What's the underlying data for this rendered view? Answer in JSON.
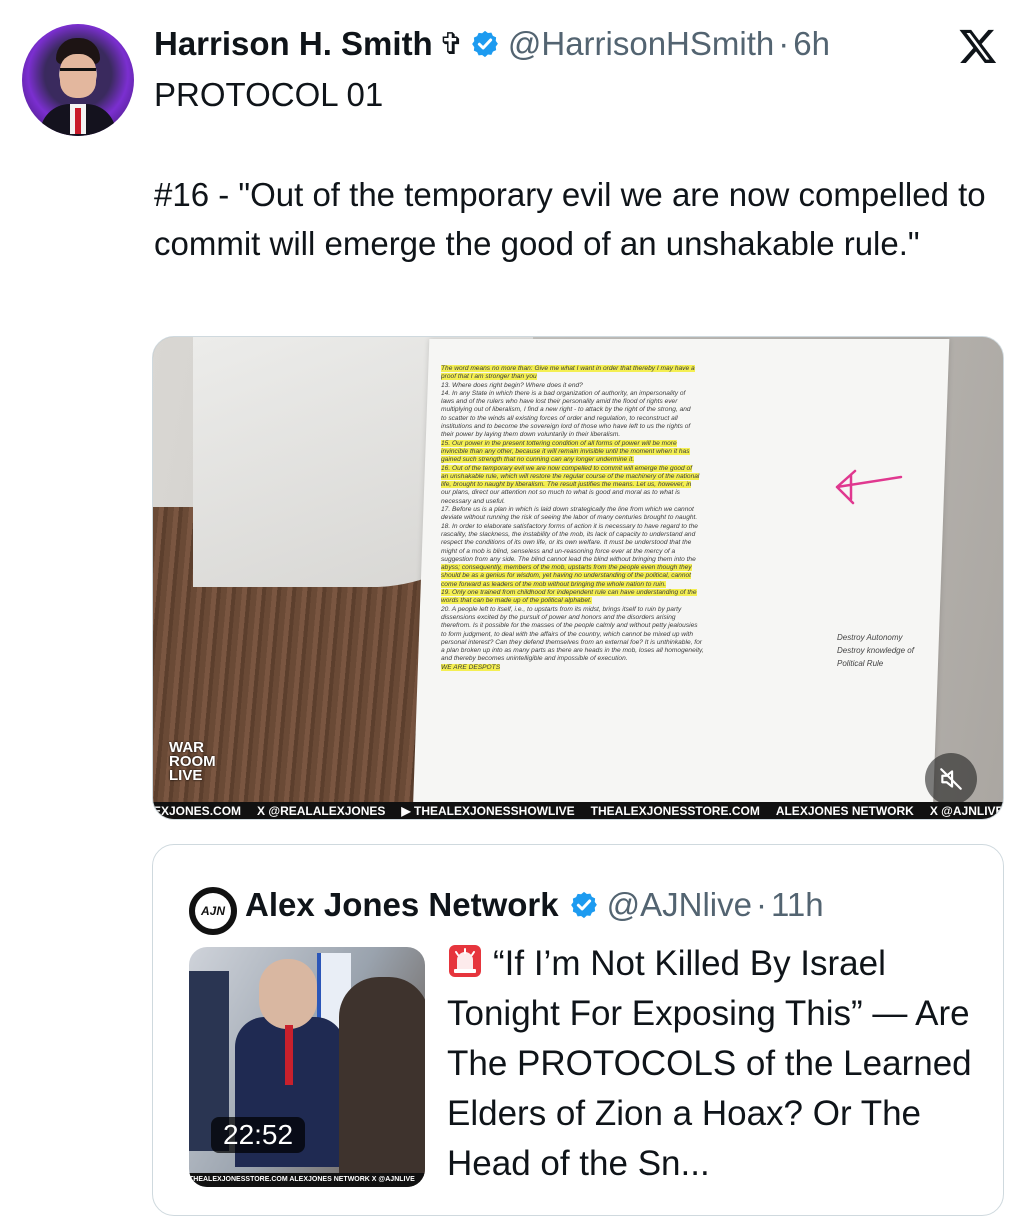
{
  "post": {
    "author_name": "Harrison H. Smith",
    "author_symbol": "✞",
    "author_handle": "@HarrisonHSmith",
    "separator": "·",
    "time": "6h",
    "subtitle": "PROTOCOL 01",
    "body": "#16 - \"Out of the temporary evil we are now compelled to commit will emerge the good of an unshakable rule.\""
  },
  "media": {
    "overlay_logo": [
      "WAR",
      "ROOM",
      "LIVE"
    ],
    "ticker": [
      "EXJONES.COM",
      "X @REALALEXJONES",
      "▶ THEALEXJONESSHOWLIVE",
      "THEALEXJONESSTORE.COM",
      "ALEXJONES NETWORK",
      "X @AJNLIVE"
    ],
    "page_lines": [
      {
        "text": "The word means no more than: Give me what I want in order that thereby I may have a",
        "hl": true
      },
      {
        "text": "proof that I am stronger than you",
        "hl": true
      },
      {
        "text": "13. Where does right begin? Where does it end?",
        "hl": false
      },
      {
        "text": "14. In any State in which there is a bad organization of authority, an impersonality of",
        "hl": false
      },
      {
        "text": "laws and of the rulers who have lost their personality amid the flood of rights ever",
        "hl": false
      },
      {
        "text": "multiplying out of liberalism, I find a new right - to attack by the right of the strong, and",
        "hl": false
      },
      {
        "text": "to scatter to the winds all existing forces of order and regulation, to reconstruct all",
        "hl": false
      },
      {
        "text": "institutions and to become the sovereign lord of those who have left to us the rights of",
        "hl": false
      },
      {
        "text": "their power by laying them down voluntarily in their liberalism.",
        "hl": false
      },
      {
        "text": "15. Our power in the present tottering condition of all forms of power will be more",
        "hl": true
      },
      {
        "text": "invincible than any other, because it will remain invisible until the moment when it has",
        "hl": true
      },
      {
        "text": "gained such strength that no cunning can any longer undermine it.",
        "hl": true
      },
      {
        "text": "16. Out of the temporary evil we are now compelled to commit will emerge the good of",
        "hl": true
      },
      {
        "text": "an unshakable rule, which will restore the regular course of the machinery of the national",
        "hl": true
      },
      {
        "text": "life, brought to naught by liberalism. The result justifies the means. Let us, however, in",
        "hl": true
      },
      {
        "text": "our plans, direct our attention not so much to what is good and moral as to what is",
        "hl": false
      },
      {
        "text": "necessary and useful.",
        "hl": false
      },
      {
        "text": "17. Before us is a plan in which is laid down strategically the line from which we cannot",
        "hl": false
      },
      {
        "text": "deviate without running the risk of seeing the labor of many centuries brought to naught.",
        "hl": false
      },
      {
        "text": "18. In order to elaborate satisfactory forms of action it is necessary to have regard to the",
        "hl": false
      },
      {
        "text": "rascality, the slackness, the instability of the mob, its lack of capacity to understand and",
        "hl": false
      },
      {
        "text": "respect the conditions of its own life, or its own welfare. It must be understood that the",
        "hl": false
      },
      {
        "text": "might of a mob is blind, senseless and un-reasoning force ever at the mercy of a",
        "hl": false
      },
      {
        "text": "suggestion from any side. The blind cannot lead the blind without bringing them into the",
        "hl": false
      },
      {
        "text": "abyss; consequently, members of the mob, upstarts from the people even though they",
        "hl": true
      },
      {
        "text": "should be as a genius for wisdom, yet having no understanding of the political, cannot",
        "hl": true
      },
      {
        "text": "come forward as leaders of the mob without bringing the whole nation to ruin.",
        "hl": true
      },
      {
        "text": "19. Only one trained from childhood for independent rule can have understanding of the",
        "hl": true
      },
      {
        "text": "words that can be made up of the political alphabet.",
        "hl": true
      },
      {
        "text": "20. A people left to itself, i.e., to upstarts from its midst, brings itself to ruin by party",
        "hl": false
      },
      {
        "text": "dissensions excited by the pursuit of power and honors and the disorders arising",
        "hl": false
      },
      {
        "text": "therefrom. Is it possible for the masses of the people calmly and without petty jealousies",
        "hl": false
      },
      {
        "text": "to form judgment, to deal with the affairs of the country, which cannot be mixed up with",
        "hl": false
      },
      {
        "text": "personal interest? Can they defend themselves from an external foe? It is unthinkable, for",
        "hl": false
      },
      {
        "text": "a plan broken up into as many parts as there are heads in the mob, loses all homogeneity,",
        "hl": false
      },
      {
        "text": "and thereby becomes unintelligible and impossible of execution.",
        "hl": false
      },
      {
        "text": "WE ARE DESPOTS",
        "hl": true
      }
    ],
    "margin_note": [
      "Destroy Autonomy",
      "Destroy knowledge of",
      "Political Rule"
    ]
  },
  "quote": {
    "avatar_text": "AJN",
    "name": "Alex Jones Network",
    "handle": "@AJNlive",
    "separator": "·",
    "time": "11h",
    "duration": "22:52",
    "thumb_ticker": "THEALEXJONESSTORE.COM   ALEXJONES NETWORK   X @AJNLIVE",
    "text": "“If I’m Not Killed By Israel Tonight For Exposing This” — Are The PROTOCOLS of the Learned Elders of Zion a Hoax? Or The Head of the Sn..."
  },
  "colors": {
    "verified": "#1d9bf0",
    "secondary_text": "#536471",
    "highlighter": "#f4ef52"
  },
  "icons": {
    "verified": "verified-badge-icon",
    "x_logo": "x-logo-icon",
    "mute": "muted-speaker-icon",
    "siren": "siren-emoji-icon"
  }
}
